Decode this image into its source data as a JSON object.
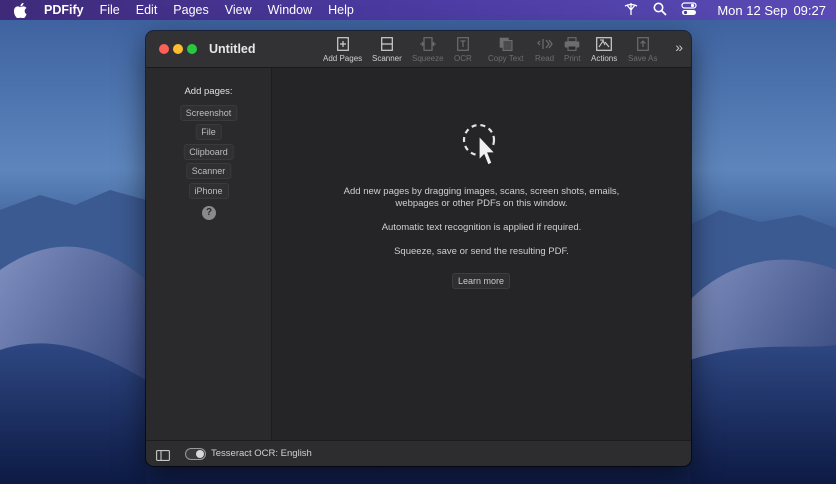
{
  "menubar": {
    "app_name": "PDFify",
    "items": [
      "File",
      "Edit",
      "Pages",
      "View",
      "Window",
      "Help"
    ],
    "date": "Mon 12 Sep",
    "time": "09:27"
  },
  "window": {
    "title": "Untitled",
    "toolbar": {
      "add_pages": "Add Pages",
      "scanner": "Scanner",
      "squeeze": "Squeeze",
      "ocr": "OCR",
      "copy_text": "Copy Text",
      "read": "Read",
      "print": "Print",
      "actions": "Actions",
      "save_as": "Save As"
    }
  },
  "sidebar": {
    "heading": "Add pages:",
    "buttons": {
      "screenshot": "Screenshot",
      "file": "File",
      "clipboard": "Clipboard",
      "scanner": "Scanner",
      "iphone": "iPhone"
    },
    "help": "?"
  },
  "main": {
    "line1": "Add new pages by dragging images, scans, screen shots, emails,",
    "line2": "webpages or other PDFs on this window.",
    "line3": "Automatic text recognition is applied if required.",
    "line4": "Squeeze, save or send the resulting PDF.",
    "learn_more": "Learn more"
  },
  "bottombar": {
    "ocr_label": "Tesseract OCR: English"
  },
  "colors": {
    "accent_close": "#fe5f57",
    "accent_min": "#febc2e",
    "accent_max": "#28c840",
    "window_bg": "#252527"
  }
}
